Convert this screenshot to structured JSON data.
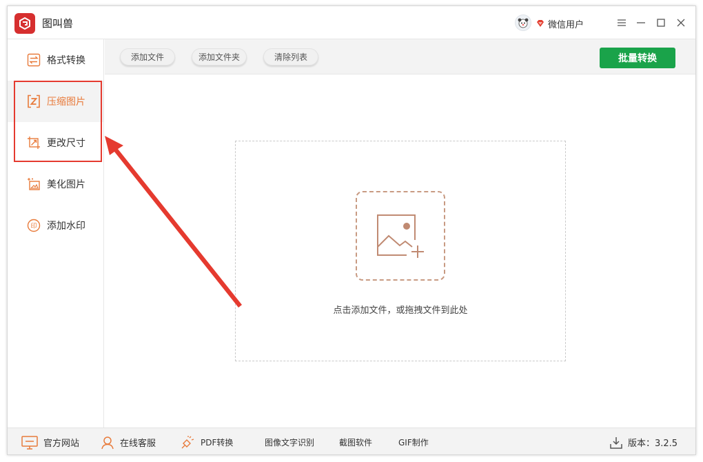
{
  "app": {
    "title": "图叫兽",
    "user_name": "微信用户"
  },
  "sidebar": {
    "items": [
      {
        "label": "格式转换",
        "icon": "format-convert-icon"
      },
      {
        "label": "压缩图片",
        "icon": "compress-icon"
      },
      {
        "label": "更改尺寸",
        "icon": "resize-icon"
      },
      {
        "label": "美化图片",
        "icon": "beautify-icon"
      },
      {
        "label": "添加水印",
        "icon": "watermark-icon"
      }
    ],
    "active_index": 1
  },
  "toolbar": {
    "add_file": "添加文件",
    "add_folder": "添加文件夹",
    "clear_list": "清除列表",
    "batch_convert": "批量转换"
  },
  "dropzone": {
    "hint": "点击添加文件，或拖拽文件到此处"
  },
  "footer": {
    "website": "官方网站",
    "support": "在线客服",
    "pdf": "PDF转换",
    "ocr": "图像文字识别",
    "screenshot": "截图软件",
    "gif": "GIF制作",
    "version": "版本：3.2.5"
  },
  "colors": {
    "accent": "#e87a3a",
    "primary_green": "#1aa34a",
    "highlight_red": "#e53a2f"
  }
}
